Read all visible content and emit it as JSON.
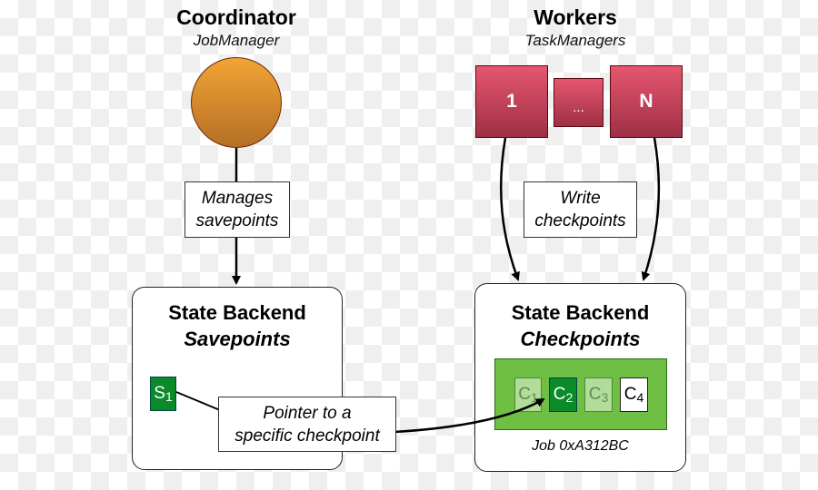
{
  "coordinator": {
    "title": "Coordinator",
    "subtitle": "JobManager",
    "color": "#e08a30"
  },
  "workers": {
    "title": "Workers",
    "subtitle": "TaskManagers",
    "boxes": [
      "1",
      "...",
      "N"
    ],
    "color": "#c8445c"
  },
  "labels": {
    "manages": [
      "Manages",
      "savepoints"
    ],
    "write": [
      "Write",
      "checkpoints"
    ],
    "pointer": [
      "Pointer to a",
      "specific checkpoint"
    ]
  },
  "savepoint_backend": {
    "title": "State Backend",
    "subtitle": "Savepoints",
    "savepoint": {
      "letter": "S",
      "index": "1",
      "color": "#0b8a2a"
    }
  },
  "checkpoint_backend": {
    "title": "State Backend",
    "subtitle": "Checkpoints",
    "job": "Job 0xA312BC",
    "panel_color": "#6fbf44",
    "checkpoints": [
      {
        "letter": "C",
        "index": "1",
        "state": "faded"
      },
      {
        "letter": "C",
        "index": "2",
        "state": "pointed"
      },
      {
        "letter": "C",
        "index": "3",
        "state": "faded"
      },
      {
        "letter": "C",
        "index": "4",
        "state": "latest"
      }
    ]
  }
}
